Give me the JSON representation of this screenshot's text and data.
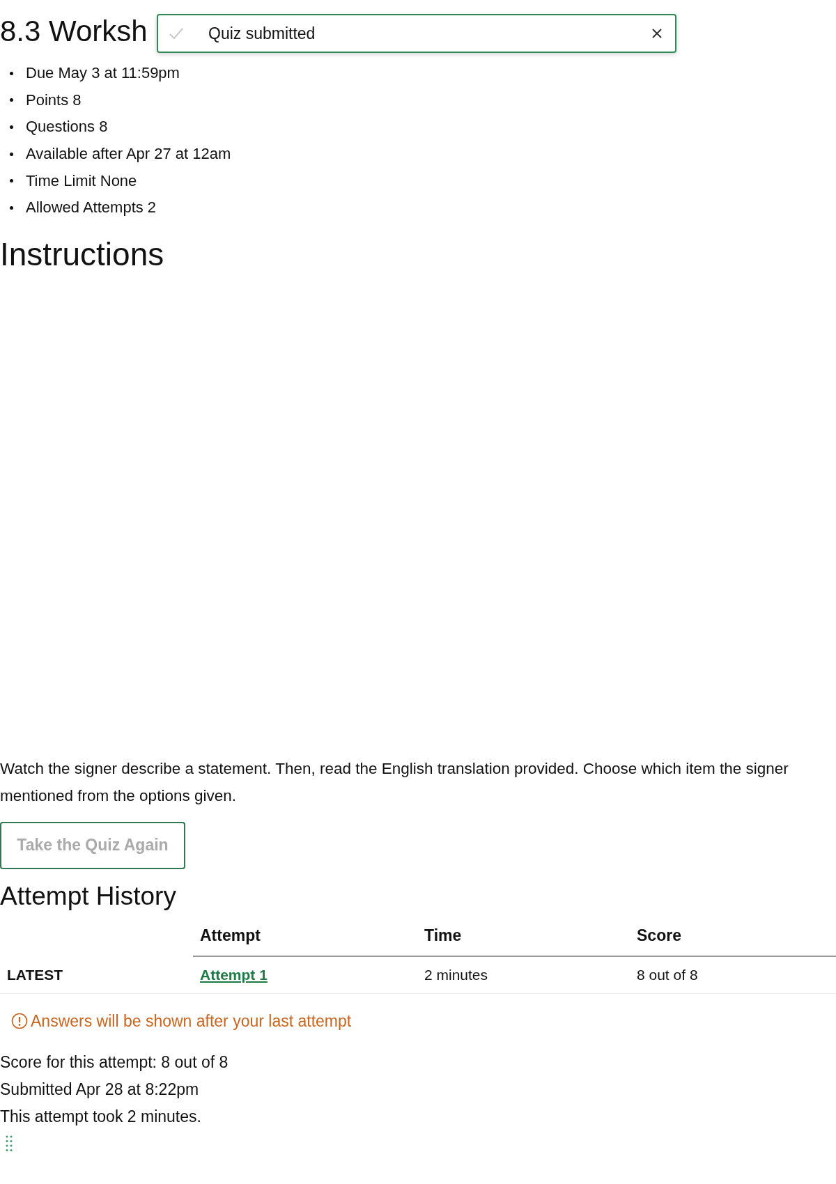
{
  "title": "8.3 Worksh",
  "toast": {
    "message": "Quiz submitted"
  },
  "details": [
    {
      "label": "Due",
      "value": "May 3 at 11:59pm"
    },
    {
      "label": "Points",
      "value": "8"
    },
    {
      "label": "Questions",
      "value": "8"
    },
    {
      "label": "Available",
      "value": "after Apr 27 at 12am"
    },
    {
      "label": "Time Limit",
      "value": "None"
    },
    {
      "label": "Allowed Attempts",
      "value": "2"
    }
  ],
  "instructions_heading": "Instructions",
  "instructions": "Watch the signer describe a statement. Then, read the English translation provided. Choose which item the signer mentioned from the options given.",
  "retake_button": {
    "label": "Take the Quiz Again",
    "disabled": true
  },
  "history_heading": "Attempt History",
  "table": {
    "columns": [
      "Attempt",
      "Time",
      "Score"
    ],
    "rows": [
      {
        "tag": "LATEST",
        "attempt": "Attempt 1",
        "time": "2 minutes",
        "score": "8 out of 8"
      }
    ]
  },
  "notice": "Answers will be shown after your last attempt",
  "summary": [
    "Score for this attempt: 8 out of 8",
    "Submitted Apr 28 at 8:22pm",
    "This attempt took 2 minutes."
  ]
}
